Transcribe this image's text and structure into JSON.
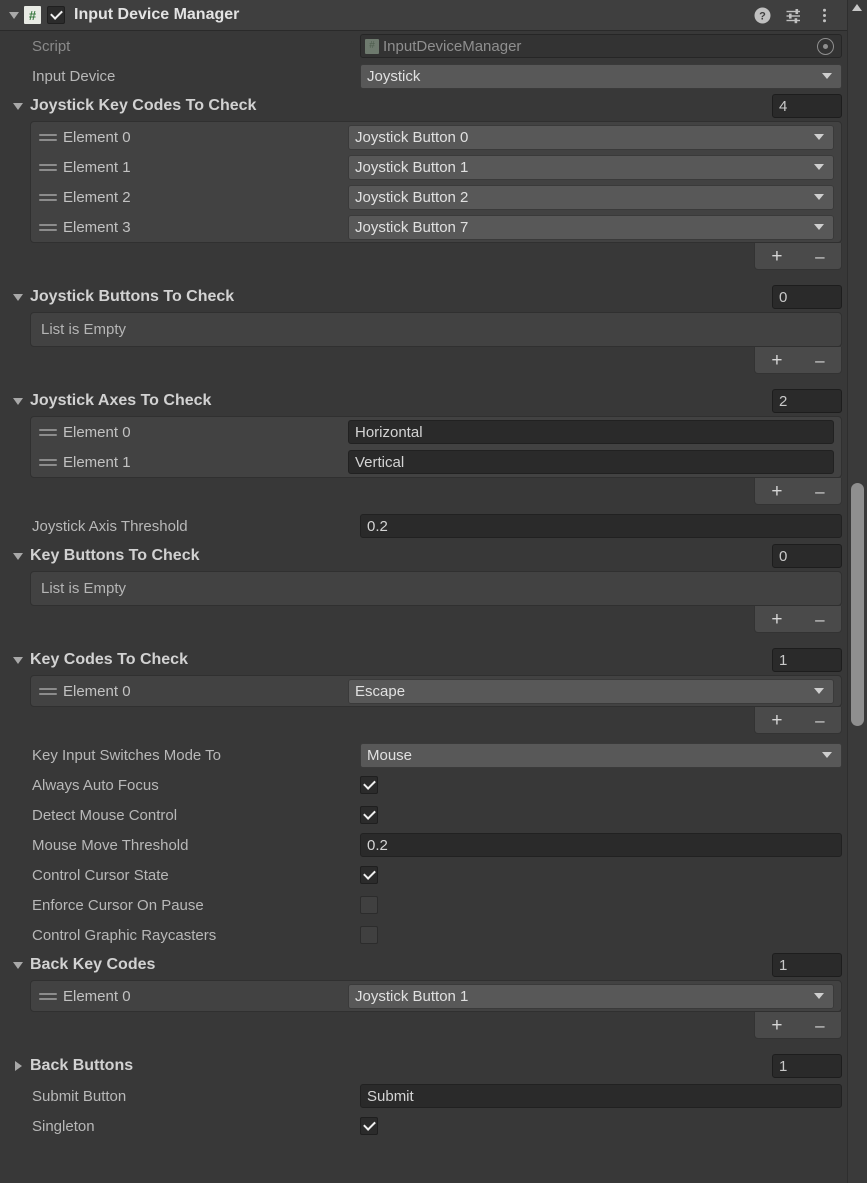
{
  "header": {
    "title": "Input Device Manager",
    "enabled": true,
    "script_icon": "script-badge-icon",
    "icons": [
      {
        "name": "help-icon",
        "label": "?"
      },
      {
        "name": "preset-icon",
        "label": "presets"
      },
      {
        "name": "more-menu-icon",
        "label": "⋮"
      }
    ]
  },
  "script_row": {
    "label": "Script",
    "value": "InputDeviceManager",
    "picker": "object-picker-icon"
  },
  "input_device": {
    "label": "Input Device",
    "value": "Joystick"
  },
  "joystick_key_codes": {
    "label": "Joystick Key Codes To Check",
    "size": "4",
    "expanded": true,
    "elements": [
      {
        "label": "Element 0",
        "value": "Joystick Button 0"
      },
      {
        "label": "Element 1",
        "value": "Joystick Button 1"
      },
      {
        "label": "Element 2",
        "value": "Joystick Button 2"
      },
      {
        "label": "Element 3",
        "value": "Joystick Button 7"
      }
    ]
  },
  "joystick_buttons": {
    "label": "Joystick Buttons To Check",
    "size": "0",
    "expanded": true,
    "empty_text": "List is Empty"
  },
  "joystick_axes": {
    "label": "Joystick Axes To Check",
    "size": "2",
    "expanded": true,
    "elements": [
      {
        "label": "Element 0",
        "value": "Horizontal"
      },
      {
        "label": "Element 1",
        "value": "Vertical"
      }
    ]
  },
  "joystick_axis_threshold": {
    "label": "Joystick Axis Threshold",
    "value": "0.2"
  },
  "key_buttons": {
    "label": "Key Buttons To Check",
    "size": "0",
    "expanded": true,
    "empty_text": "List is Empty"
  },
  "key_codes": {
    "label": "Key Codes To Check",
    "size": "1",
    "expanded": true,
    "elements": [
      {
        "label": "Element 0",
        "value": "Escape"
      }
    ]
  },
  "key_input_switches_mode_to": {
    "label": "Key Input Switches Mode To",
    "value": "Mouse"
  },
  "always_auto_focus": {
    "label": "Always Auto Focus",
    "checked": true
  },
  "detect_mouse_control": {
    "label": "Detect Mouse Control",
    "checked": true
  },
  "mouse_move_threshold": {
    "label": "Mouse Move Threshold",
    "value": "0.2"
  },
  "control_cursor_state": {
    "label": "Control Cursor State",
    "checked": true
  },
  "enforce_cursor_on_pause": {
    "label": "Enforce Cursor On Pause",
    "checked": false
  },
  "control_graphic_raycasters": {
    "label": "Control Graphic Raycasters",
    "checked": false
  },
  "back_key_codes": {
    "label": "Back Key Codes",
    "size": "1",
    "expanded": true,
    "elements": [
      {
        "label": "Element 0",
        "value": "Joystick Button 1"
      }
    ]
  },
  "back_buttons": {
    "label": "Back Buttons",
    "size": "1",
    "expanded": false
  },
  "submit_button": {
    "label": "Submit Button",
    "value": "Submit"
  },
  "singleton": {
    "label": "Singleton",
    "checked": true
  },
  "list_controls": {
    "add": "+",
    "remove": "–"
  },
  "colors": {
    "window_bg": "#383838",
    "header_bg": "#3f3f3f",
    "listbox_bg": "#424242",
    "field_bg": "#2a2a2a",
    "dropdown_bg": "#585858",
    "text": "#c4c4c4",
    "script_green": "#3c7a42",
    "scrollbar_thumb": "#8f8f8f"
  }
}
